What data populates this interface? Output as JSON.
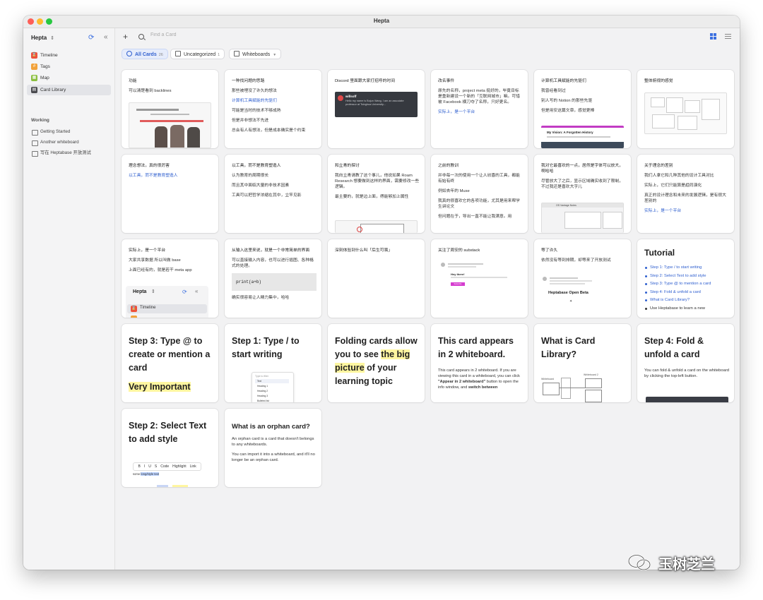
{
  "window": {
    "title": "Hepta"
  },
  "sidebar": {
    "workspace": "Hepta",
    "items": [
      {
        "label": "Timeline",
        "color": "#f0523a",
        "glyph": "⌛"
      },
      {
        "label": "Tags",
        "color": "#f2a23a",
        "glyph": "#"
      },
      {
        "label": "Map",
        "color": "#8bbf3f",
        "glyph": "▦"
      },
      {
        "label": "Card Library",
        "color": "#4a4a4f",
        "glyph": "▤"
      }
    ],
    "section_label": "Working",
    "whiteboards": [
      "Getting Started",
      "Another whiteboard",
      "写在 Heptabase 开放测试"
    ]
  },
  "toolbar": {
    "search_placeholder": "Find a Card"
  },
  "filters": [
    {
      "label": "All Cards",
      "count": "26"
    },
    {
      "label": "Uncategorized",
      "count": "1"
    },
    {
      "label": "Whiteboards",
      "count": ""
    }
  ],
  "cards": {
    "c1": {
      "lines": [
        "功能",
        "可以清楚看到 backlines"
      ]
    },
    "c2": {
      "lines": [
        "一种找问题的思路",
        "那些被埋没了许久的想法",
        "计算机工具赋能的先驱们",
        "可能是当时的技术不够成熟",
        "但是并非想法不先进",
        "总会有人有想法，但是成本确实是个约束"
      ]
    },
    "c3": {
      "lines": [
        "Discord 里面跟大家打招呼的时间"
      ],
      "msg_name": "willsoff",
      "msg_text": "Hello my name is Bojun Wang. I am an associate professor at Tsinghua University..."
    },
    "c4": {
      "lines": [
        "改名事件",
        "原先的名称，project meta 挺好的，毕竟目标是重新建设一个新的「互联网城市」嘛。可惜被 Facebook 横刀夺了名称，只好更名。",
        "实际上，是一个平台"
      ]
    },
    "c5": {
      "lines": [
        "计算机工具赋能的先驱们",
        "我曾经看到过",
        "别人写的 Notion 的那些先驱",
        "但是用安这篇文章，感觉更棒"
      ],
      "thumb_title": "My Vision: A Forgotten History"
    },
    "c6": {
      "lines": [
        "整体俯视的感觉"
      ]
    },
    "c7": {
      "lines": [
        "理念想法，真的很厉害",
        "以工具，而不是教育塑造人"
      ]
    },
    "c8": {
      "lines": [
        "以工具，而不是教育塑造人",
        "认为教育的周期很长",
        "而且其中面临大量的非技术因素",
        "工具可以把哲学浓缩在其中，立竿见影"
      ]
    },
    "c9": {
      "lines": [
        "和立青的探讨",
        "我向立青请教了这个事儿，他说如果 Roam Research 想要做到这样的界面，需要修改一些逻辑。",
        "最主要的，就是边上面，得能够加上属性"
      ]
    },
    "c10": {
      "lines": [
        "之前的教训",
        "并非每一次的使用一个让人欣喜的工具，都能有始有终",
        "例如去年的 Muse",
        "我真的很喜欢它的各项功能，尤其是用来帮学生讲论文",
        "但问题在于，导出一直不能让我满意。用"
      ]
    },
    "c11": {
      "lines": [
        "我对它最喜欢的一点，居然是字体可以放大，啊哈哈",
        "尽管放大了之后，显示区域确实收到了限制，不过我还是喜欢大字儿"
      ],
      "thumb_title": "OS Vantage Notes"
    },
    "c12": {
      "lines": [
        "关于理念的差别",
        "我们人拿它和几种其他的设计工具对比",
        "实际上，它们只能算是趋同演化",
        "真正的设计理念和未来的发展逻辑，是有很大差别的",
        "实际上，是一个平台"
      ]
    },
    "c13": {
      "lines": [
        "实际上，是一个平台",
        "大家共享数据 所以叫做 base",
        "上面已经有的，就是若干 meta app"
      ],
      "mini_ws": "Hepta",
      "mini_item": "Timeline"
    },
    "c14": {
      "lines": [
        "从输入这里来说，就是一个非常简单的界面",
        "可以直接输入内容，也可以进行插图、各种格式的处理。",
        "确实很容易让人精力集中，哈哈"
      ],
      "code": "print(a+b)"
    },
    "c15": {
      "lines": [
        "深刻体验到什么叫「后生可畏」"
      ]
    },
    "c16": {
      "lines": [
        "关注了周安的 substack"
      ],
      "thumb_title": "Hey there!",
      "thumb_btn": "Subscribe"
    },
    "c17": {
      "lines": [
        "等了许久",
        "依然没有等到排期，却等来了开放测试"
      ],
      "thumb_title": "Heptabase Open Beta"
    },
    "c18": {
      "title": "Tutorial",
      "items": [
        "Step 1: Type / to start writing",
        "Step 2: Select Text to add style",
        "Step 3: Type @ to mention a card",
        "Step 4: Fold & unfold a card",
        "What is Card Library?",
        "Use Heptabase to learn a new"
      ]
    },
    "c19": {
      "title": "Step 3: Type @ to create or mention a card",
      "highlight": "Very Important"
    },
    "c20": {
      "title": "Step 1: Type / to start writing",
      "menu_title": "Type to filter",
      "menu_items": [
        "Text",
        "Heading 1",
        "Heading 2",
        "Heading 3",
        "Bulleted list"
      ]
    },
    "c21": {
      "pre": "Folding cards allow you to see ",
      "hl": "the big picture",
      "post": " of your learning topic"
    },
    "c22": {
      "title": "This card appears in 2 whiteboard.",
      "p1": "This card appears in 2 whiteboard. If you are viewing this card in a whiteboard, you can click ",
      "b1": "\"Appear in 2 whiteboard\"",
      "p2": " button to open the info window, and ",
      "b2": "switch between"
    },
    "c23": {
      "title": "What is Card Library?",
      "label1": "Whiteboard",
      "label2": "Whiteboard 2"
    },
    "c24": {
      "title": "Step 4: Fold & unfold a card",
      "body": "You can fold & unfold a card on the whiteboard by clicking the top-left button."
    },
    "c25": {
      "title": "Step 2: Select Text to add style",
      "tools": [
        "B",
        "I",
        "U",
        "S",
        "Code",
        "Highlight",
        "Link"
      ],
      "sample": "some",
      "sample_hl": "long/style text"
    },
    "c26": {
      "title": "What is an orphan card?",
      "p1": "An orphan card is a card that doesn't belongs to any whiteboards.",
      "p2": "You can import it into a whiteboard, and it'll no longer be an orphan card."
    }
  },
  "watermark": "玉树芝兰"
}
